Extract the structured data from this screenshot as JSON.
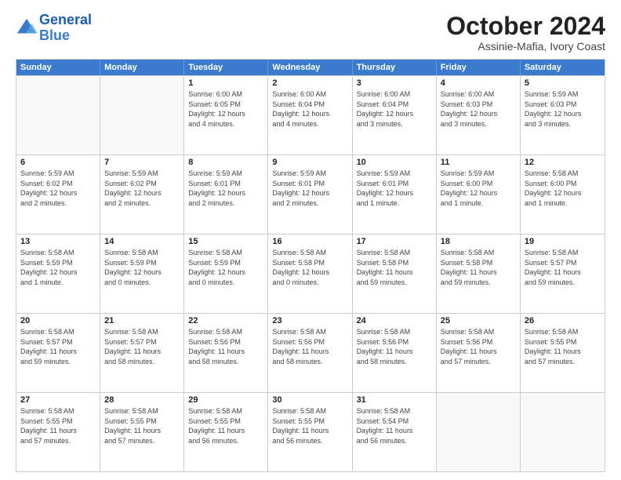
{
  "header": {
    "logo_line1": "General",
    "logo_line2": "Blue",
    "month": "October 2024",
    "location": "Assinie-Mafia, Ivory Coast"
  },
  "weekdays": [
    "Sunday",
    "Monday",
    "Tuesday",
    "Wednesday",
    "Thursday",
    "Friday",
    "Saturday"
  ],
  "rows": [
    [
      {
        "day": "",
        "info": ""
      },
      {
        "day": "",
        "info": ""
      },
      {
        "day": "1",
        "info": "Sunrise: 6:00 AM\nSunset: 6:05 PM\nDaylight: 12 hours\nand 4 minutes."
      },
      {
        "day": "2",
        "info": "Sunrise: 6:00 AM\nSunset: 6:04 PM\nDaylight: 12 hours\nand 4 minutes."
      },
      {
        "day": "3",
        "info": "Sunrise: 6:00 AM\nSunset: 6:04 PM\nDaylight: 12 hours\nand 3 minutes."
      },
      {
        "day": "4",
        "info": "Sunrise: 6:00 AM\nSunset: 6:03 PM\nDaylight: 12 hours\nand 3 minutes."
      },
      {
        "day": "5",
        "info": "Sunrise: 5:59 AM\nSunset: 6:03 PM\nDaylight: 12 hours\nand 3 minutes."
      }
    ],
    [
      {
        "day": "6",
        "info": "Sunrise: 5:59 AM\nSunset: 6:02 PM\nDaylight: 12 hours\nand 2 minutes."
      },
      {
        "day": "7",
        "info": "Sunrise: 5:59 AM\nSunset: 6:02 PM\nDaylight: 12 hours\nand 2 minutes."
      },
      {
        "day": "8",
        "info": "Sunrise: 5:59 AM\nSunset: 6:01 PM\nDaylight: 12 hours\nand 2 minutes."
      },
      {
        "day": "9",
        "info": "Sunrise: 5:59 AM\nSunset: 6:01 PM\nDaylight: 12 hours\nand 2 minutes."
      },
      {
        "day": "10",
        "info": "Sunrise: 5:59 AM\nSunset: 6:01 PM\nDaylight: 12 hours\nand 1 minute."
      },
      {
        "day": "11",
        "info": "Sunrise: 5:59 AM\nSunset: 6:00 PM\nDaylight: 12 hours\nand 1 minute."
      },
      {
        "day": "12",
        "info": "Sunrise: 5:58 AM\nSunset: 6:00 PM\nDaylight: 12 hours\nand 1 minute."
      }
    ],
    [
      {
        "day": "13",
        "info": "Sunrise: 5:58 AM\nSunset: 5:59 PM\nDaylight: 12 hours\nand 1 minute."
      },
      {
        "day": "14",
        "info": "Sunrise: 5:58 AM\nSunset: 5:59 PM\nDaylight: 12 hours\nand 0 minutes."
      },
      {
        "day": "15",
        "info": "Sunrise: 5:58 AM\nSunset: 5:59 PM\nDaylight: 12 hours\nand 0 minutes."
      },
      {
        "day": "16",
        "info": "Sunrise: 5:58 AM\nSunset: 5:58 PM\nDaylight: 12 hours\nand 0 minutes."
      },
      {
        "day": "17",
        "info": "Sunrise: 5:58 AM\nSunset: 5:58 PM\nDaylight: 11 hours\nand 59 minutes."
      },
      {
        "day": "18",
        "info": "Sunrise: 5:58 AM\nSunset: 5:58 PM\nDaylight: 11 hours\nand 59 minutes."
      },
      {
        "day": "19",
        "info": "Sunrise: 5:58 AM\nSunset: 5:57 PM\nDaylight: 11 hours\nand 59 minutes."
      }
    ],
    [
      {
        "day": "20",
        "info": "Sunrise: 5:58 AM\nSunset: 5:57 PM\nDaylight: 11 hours\nand 59 minutes."
      },
      {
        "day": "21",
        "info": "Sunrise: 5:58 AM\nSunset: 5:57 PM\nDaylight: 11 hours\nand 58 minutes."
      },
      {
        "day": "22",
        "info": "Sunrise: 5:58 AM\nSunset: 5:56 PM\nDaylight: 11 hours\nand 58 minutes."
      },
      {
        "day": "23",
        "info": "Sunrise: 5:58 AM\nSunset: 5:56 PM\nDaylight: 11 hours\nand 58 minutes."
      },
      {
        "day": "24",
        "info": "Sunrise: 5:58 AM\nSunset: 5:56 PM\nDaylight: 11 hours\nand 58 minutes."
      },
      {
        "day": "25",
        "info": "Sunrise: 5:58 AM\nSunset: 5:56 PM\nDaylight: 11 hours\nand 57 minutes."
      },
      {
        "day": "26",
        "info": "Sunrise: 5:58 AM\nSunset: 5:55 PM\nDaylight: 11 hours\nand 57 minutes."
      }
    ],
    [
      {
        "day": "27",
        "info": "Sunrise: 5:58 AM\nSunset: 5:55 PM\nDaylight: 11 hours\nand 57 minutes."
      },
      {
        "day": "28",
        "info": "Sunrise: 5:58 AM\nSunset: 5:55 PM\nDaylight: 11 hours\nand 57 minutes."
      },
      {
        "day": "29",
        "info": "Sunrise: 5:58 AM\nSunset: 5:55 PM\nDaylight: 11 hours\nand 56 minutes."
      },
      {
        "day": "30",
        "info": "Sunrise: 5:58 AM\nSunset: 5:55 PM\nDaylight: 11 hours\nand 56 minutes."
      },
      {
        "day": "31",
        "info": "Sunrise: 5:58 AM\nSunset: 5:54 PM\nDaylight: 11 hours\nand 56 minutes."
      },
      {
        "day": "",
        "info": ""
      },
      {
        "day": "",
        "info": ""
      }
    ]
  ]
}
